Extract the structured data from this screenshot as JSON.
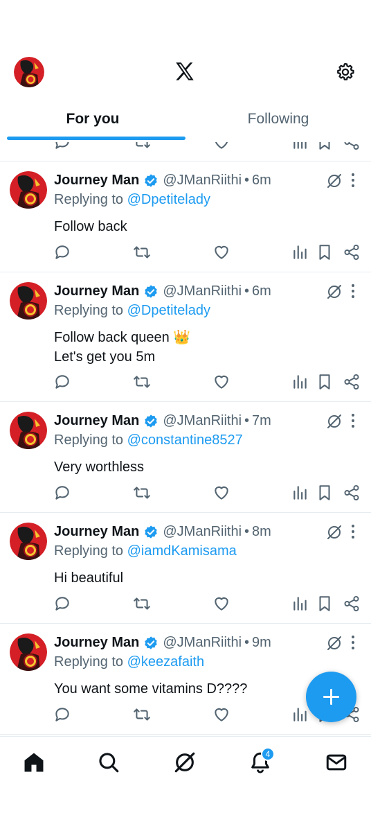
{
  "header": {
    "tabs": [
      {
        "label": "For you",
        "active": true
      },
      {
        "label": "Following",
        "active": false
      }
    ],
    "icons": {
      "avatar": "avatar",
      "logo": "x-logo-icon",
      "settings": "gear-icon"
    }
  },
  "colors": {
    "accent": "#1d9bf0",
    "text": "#0f1419",
    "muted": "#536471"
  },
  "tweets": [
    {
      "name": "Journey Man",
      "handle": "@JManRiithi",
      "time": "6m",
      "reply_prefix": "Replying to",
      "reply_to": "@Dpetitelady",
      "text": "Follow back"
    },
    {
      "name": "Journey Man",
      "handle": "@JManRiithi",
      "time": "6m",
      "reply_prefix": "Replying to",
      "reply_to": "@Dpetitelady",
      "text": "Follow back queen 👑\nLet's get you 5m"
    },
    {
      "name": "Journey Man",
      "handle": "@JManRiithi",
      "time": "7m",
      "reply_prefix": "Replying to",
      "reply_to": "@constantine8527",
      "text": "Very worthless"
    },
    {
      "name": "Journey Man",
      "handle": "@JManRiithi",
      "time": "8m",
      "reply_prefix": "Replying to",
      "reply_to": "@iamdKamisama",
      "text": "Hi beautiful"
    },
    {
      "name": "Journey Man",
      "handle": "@JManRiithi",
      "time": "9m",
      "reply_prefix": "Replying to",
      "reply_to": "@keezafaith",
      "text": "You want some vitamins D????"
    }
  ],
  "bottom_nav": {
    "items": [
      "home-icon",
      "search-icon",
      "grok-icon",
      "notifications-icon",
      "messages-icon"
    ],
    "notification_count": "4"
  },
  "fab": {
    "icon": "plus-icon"
  }
}
